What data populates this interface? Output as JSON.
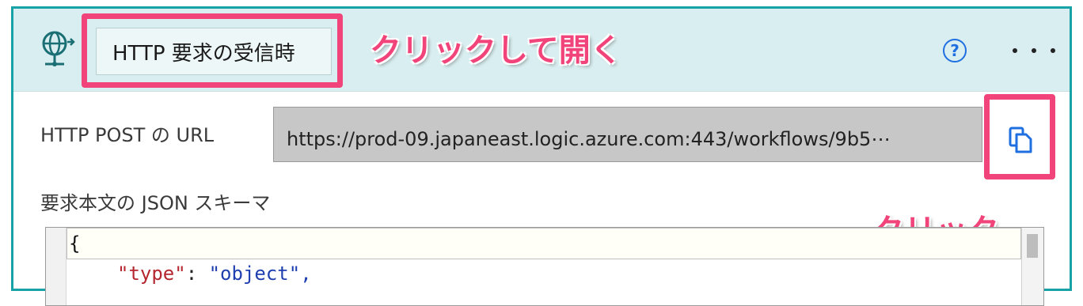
{
  "header": {
    "title": "HTTP 要求の受信時",
    "help_symbol": "?",
    "icons": {
      "trigger": "globe-network-icon",
      "help": "help-icon",
      "more": "more-options-icon"
    }
  },
  "annotations": {
    "open_hint": "クリックして開く",
    "copy_hint": "クリック",
    "highlight_color": "#f0447a"
  },
  "url_field": {
    "label": "HTTP POST の URL",
    "value": "https://prod-09.japaneast.logic.azure.com:443/workflows/9b5⋯",
    "copy_icon": "copy-icon"
  },
  "schema": {
    "label": "要求本文の JSON スキーマ",
    "line1": "{",
    "line2_key": "\"type\"",
    "line2_sep": ": ",
    "line2_value": "\"object\","
  },
  "colors": {
    "accent": "#17a2a6",
    "header_bg": "#d9eef0",
    "link_blue": "#1f6fe0"
  }
}
